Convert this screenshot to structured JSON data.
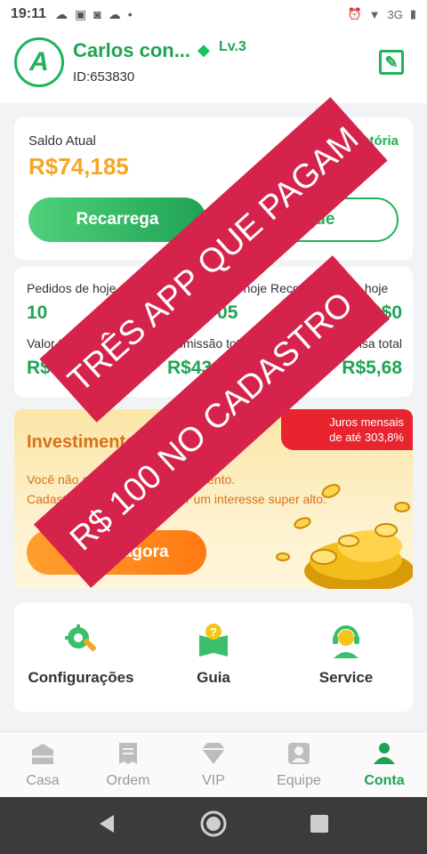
{
  "status_bar": {
    "time": "19:11",
    "network": "3G"
  },
  "header": {
    "name": "Carlos con...",
    "level": "Lv.3",
    "id": "ID:653830"
  },
  "balance": {
    "label": "Saldo Atual",
    "history": "História",
    "value": "R$74,185",
    "recharge": "Recarrega",
    "withdraw": "Saque"
  },
  "stats": [
    {
      "label": "Pedidos de hoje",
      "value": "10"
    },
    {
      "label": "Comissão de hoje",
      "value": "R$3,705"
    },
    {
      "label": "Recompensa de hoje",
      "value": "R$0"
    },
    {
      "label": "Valor total",
      "value": "R$74,185"
    },
    {
      "label": "Comissão total",
      "value": "R$43,8"
    },
    {
      "label": "Recompensa total",
      "value": "R$5,68"
    }
  ],
  "invest": {
    "title": "Investimento",
    "badge_line1": "Juros mensais",
    "badge_line2": "de até 303,8%",
    "desc_line1": "Você não abriu nenhum investimento.",
    "desc_line2": "Cadastre-se agora para obter um interesse super alto.",
    "button": "Invista agora"
  },
  "menu": [
    {
      "label": "Configurações",
      "icon": "gear-wrench-icon"
    },
    {
      "label": "Guia",
      "icon": "guide-book-icon"
    },
    {
      "label": "Service",
      "icon": "support-headset-icon"
    }
  ],
  "nav": [
    {
      "label": "Casa",
      "icon": "home-icon"
    },
    {
      "label": "Ordem",
      "icon": "order-icon"
    },
    {
      "label": "VIP",
      "icon": "vip-diamond-icon"
    },
    {
      "label": "Equipe",
      "icon": "team-icon"
    },
    {
      "label": "Conta",
      "icon": "account-icon",
      "active": true
    }
  ],
  "overlay": {
    "line1": "TRÊS APP QUE PAGAM",
    "line2": "R$ 100 NO CADASTRO"
  },
  "colors": {
    "primary_green": "#1fa353",
    "balance_orange": "#f5a623",
    "banner_red": "#d6234c",
    "badge_red": "#e8242f"
  }
}
